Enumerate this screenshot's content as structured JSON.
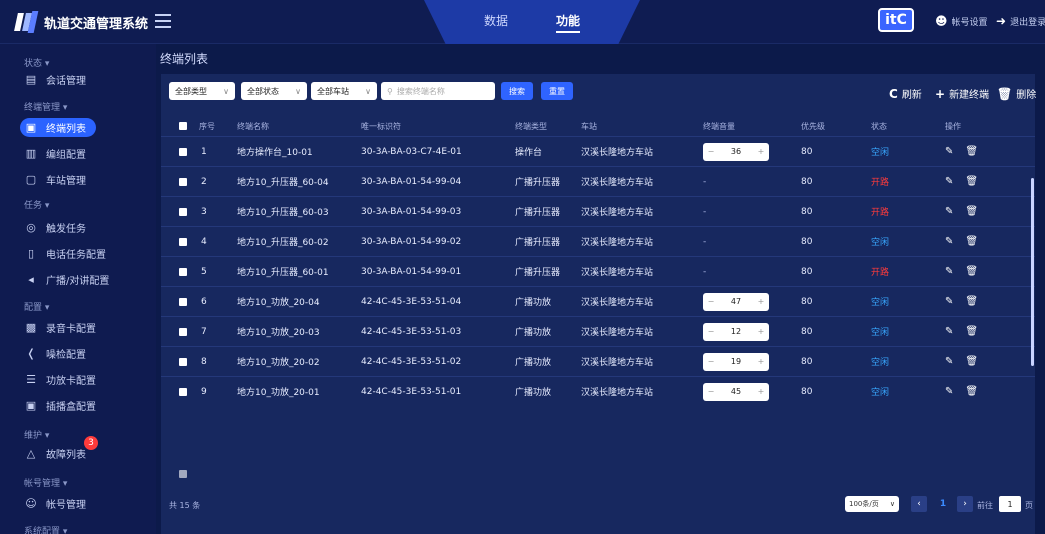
{
  "app": {
    "title": "轨道交通管理系统",
    "brand": "itC"
  },
  "top_tabs": [
    {
      "label": "数据"
    },
    {
      "label": "功能"
    }
  ],
  "header": {
    "account_settings": "帐号设置",
    "logout": "退出登录"
  },
  "sidebar": {
    "groups": [
      {
        "label": "状态 ▾",
        "items": [
          {
            "label": "会话管理",
            "icon": "chat-icon"
          }
        ]
      },
      {
        "label": "终端管理 ▾",
        "items": [
          {
            "label": "终端列表",
            "icon": "terminal-icon",
            "active": true
          },
          {
            "label": "编组配置",
            "icon": "group-icon"
          },
          {
            "label": "车站管理",
            "icon": "station-icon"
          }
        ]
      },
      {
        "label": "任务 ▾",
        "items": [
          {
            "label": "触发任务",
            "icon": "trigger-icon"
          },
          {
            "label": "电话任务配置",
            "icon": "phone-icon"
          },
          {
            "label": "广播/对讲配置",
            "icon": "megaphone-icon"
          }
        ]
      },
      {
        "label": "配置 ▾",
        "items": [
          {
            "label": "录音卡配置",
            "icon": "record-card-icon"
          },
          {
            "label": "噪检配置",
            "icon": "noise-icon"
          },
          {
            "label": "功放卡配置",
            "icon": "amp-card-icon"
          },
          {
            "label": "插播盒配置",
            "icon": "insert-box-icon"
          }
        ]
      },
      {
        "label": "维护 ▾",
        "items": [
          {
            "label": "故障列表",
            "icon": "warning-icon",
            "badge": "3"
          }
        ]
      },
      {
        "label": "帐号管理 ▾",
        "items": [
          {
            "label": "帐号管理",
            "icon": "user-icon"
          }
        ]
      },
      {
        "label": "系统配置 ▾",
        "items": []
      }
    ]
  },
  "page": {
    "title": "终端列表"
  },
  "filters": {
    "type": "全部类型",
    "status": "全部状态",
    "station": "全部车站",
    "search_placeholder": "搜索终端名称",
    "search_btn": "搜索",
    "reset_btn": "重置"
  },
  "actions": {
    "refresh": "刷新",
    "add": "新建终端",
    "delete": "删除"
  },
  "table": {
    "headers": [
      "序号",
      "终端名称",
      "唯一标识符",
      "终端类型",
      "车站",
      "终端音量",
      "优先级",
      "状态",
      "操作"
    ],
    "rows": [
      {
        "no": "1",
        "name": "地方操作台_10-01",
        "uid": "30-3A-BA-03-C7-4E-01",
        "type": "操作台",
        "station": "汉溪长隆地方车站",
        "volume": "36",
        "priority": "80",
        "status": "空闲",
        "status_kind": "idle"
      },
      {
        "no": "2",
        "name": "地方10_升压器_60-04",
        "uid": "30-3A-BA-01-54-99-04",
        "type": "广播升压器",
        "station": "汉溪长隆地方车站",
        "volume": "-",
        "priority": "80",
        "status": "开路",
        "status_kind": "open"
      },
      {
        "no": "3",
        "name": "地方10_升压器_60-03",
        "uid": "30-3A-BA-01-54-99-03",
        "type": "广播升压器",
        "station": "汉溪长隆地方车站",
        "volume": "-",
        "priority": "80",
        "status": "开路",
        "status_kind": "open"
      },
      {
        "no": "4",
        "name": "地方10_升压器_60-02",
        "uid": "30-3A-BA-01-54-99-02",
        "type": "广播升压器",
        "station": "汉溪长隆地方车站",
        "volume": "-",
        "priority": "80",
        "status": "空闲",
        "status_kind": "idle"
      },
      {
        "no": "5",
        "name": "地方10_升压器_60-01",
        "uid": "30-3A-BA-01-54-99-01",
        "type": "广播升压器",
        "station": "汉溪长隆地方车站",
        "volume": "-",
        "priority": "80",
        "status": "开路",
        "status_kind": "open"
      },
      {
        "no": "6",
        "name": "地方10_功放_20-04",
        "uid": "42-4C-45-3E-53-51-04",
        "type": "广播功放",
        "station": "汉溪长隆地方车站",
        "volume": "47",
        "priority": "80",
        "status": "空闲",
        "status_kind": "idle"
      },
      {
        "no": "7",
        "name": "地方10_功放_20-03",
        "uid": "42-4C-45-3E-53-51-03",
        "type": "广播功放",
        "station": "汉溪长隆地方车站",
        "volume": "12",
        "priority": "80",
        "status": "空闲",
        "status_kind": "idle"
      },
      {
        "no": "8",
        "name": "地方10_功放_20-02",
        "uid": "42-4C-45-3E-53-51-02",
        "type": "广播功放",
        "station": "汉溪长隆地方车站",
        "volume": "19",
        "priority": "80",
        "status": "空闲",
        "status_kind": "idle"
      },
      {
        "no": "9",
        "name": "地方10_功放_20-01",
        "uid": "42-4C-45-3E-53-51-01",
        "type": "广播功放",
        "station": "汉溪长隆地方车站",
        "volume": "45",
        "priority": "80",
        "status": "空闲",
        "status_kind": "idle"
      }
    ]
  },
  "pagination": {
    "total": "共 15 条",
    "page_size": "100条/页",
    "current": "1",
    "goto_label": "前往",
    "goto_value": "1",
    "unit": "页"
  },
  "colors": {
    "accent": "#2f64ff",
    "idle": "#38a8ff",
    "open": "#ff3b3b",
    "bg": "#0c1a4a",
    "panel": "#17285f"
  }
}
